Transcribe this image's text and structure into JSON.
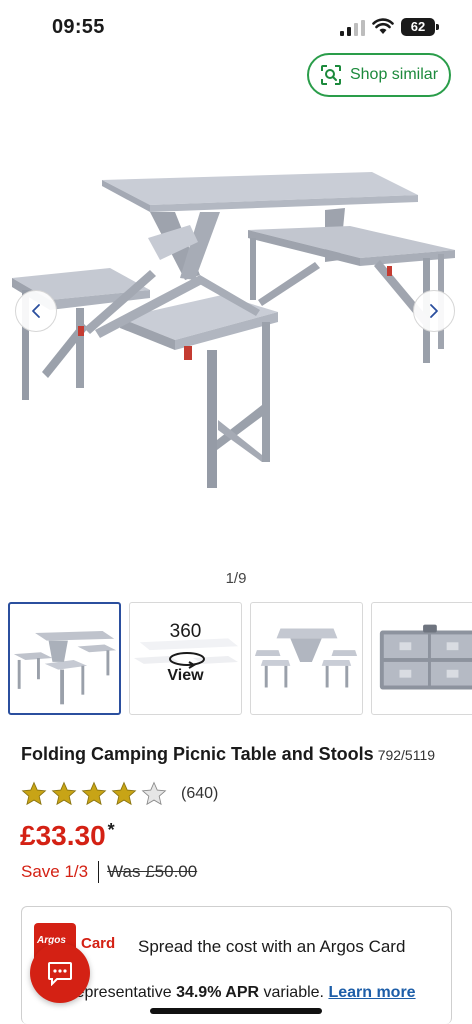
{
  "status_bar": {
    "time": "09:55",
    "battery": "62"
  },
  "shop_similar": {
    "label": "Shop similar"
  },
  "gallery": {
    "counter": "1/9",
    "thumbnails": [
      {
        "label": ""
      },
      {
        "number": "360",
        "label": "View"
      },
      {
        "label": ""
      },
      {
        "label": ""
      }
    ]
  },
  "product": {
    "title": "Folding Camping Picnic Table and Stools",
    "sku": "792/5119",
    "rating": 4,
    "rating_max": 5,
    "review_count": "(640)",
    "price": "£33.30",
    "price_note": "*",
    "save": "Save 1/3",
    "was": "Was £50.00"
  },
  "finance": {
    "card_logo_text": "Argos",
    "card_label": "Card",
    "headline": "Spread the cost with an Argos Card",
    "line_prefix": "Representative ",
    "apr": "34.9% APR",
    "line_suffix": " variable. ",
    "learn_more": "Learn more"
  },
  "colors": {
    "accent_red": "#d42114",
    "green": "#2a9d4a",
    "link_blue": "#1d5ea8",
    "star_gold": "#c8a416"
  }
}
